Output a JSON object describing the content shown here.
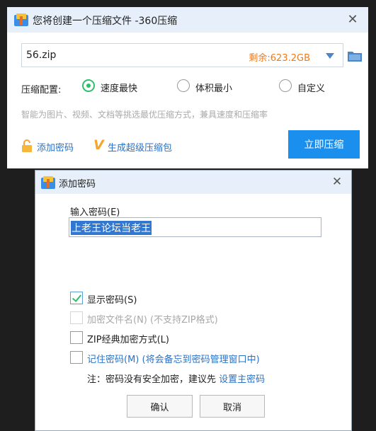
{
  "main_window": {
    "title": "您将创建一个压缩文件 -360压缩",
    "close_glyph": "✕",
    "path_value": "56.zip",
    "free_space": "剩余:623.2GB",
    "config_label": "压缩配置:",
    "options": [
      {
        "label": "速度最快",
        "selected": true
      },
      {
        "label": "体积最小",
        "selected": false
      },
      {
        "label": "自定义",
        "selected": false
      }
    ],
    "hint": "智能为图片、视频、文档等挑选最优压缩方式，兼具速度和压缩率",
    "add_password": "添加密码",
    "super_pack_mark": "V",
    "super_pack": "生成超级压缩包",
    "compress_button": "立即压缩"
  },
  "password_dialog": {
    "title": "添加密码",
    "close_glyph": "✕",
    "input_label": "输入密码(E)",
    "input_value": "上老王论坛当老王",
    "checkboxes": [
      {
        "label": "显示密码(S)",
        "checked": true,
        "enabled": true
      },
      {
        "label": "加密文件名(N) (不支持ZIP格式)",
        "checked": false,
        "enabled": false
      },
      {
        "label": "ZIP经典加密方式(L)",
        "checked": false,
        "enabled": true
      },
      {
        "label": "记住密码(M) (将会备忘到密码管理窗口中)",
        "checked": false,
        "enabled": true
      }
    ],
    "note_prefix": "注：密码没有安全加密，建议先 ",
    "note_link": "设置主密码",
    "ok_button": "确认",
    "cancel_button": "取消"
  },
  "colors": {
    "accent_blue": "#1a8fed",
    "link_blue": "#2a72c4",
    "free_space_orange": "#f07a17",
    "radio_green": "#2fbf6b",
    "titlebar_bg": "#e7f0fa"
  },
  "icons": {
    "app": "archive-app-icon",
    "dropdown": "chevron-down-icon",
    "folder": "folder-icon",
    "lock": "lock-icon",
    "close": "close-icon"
  }
}
